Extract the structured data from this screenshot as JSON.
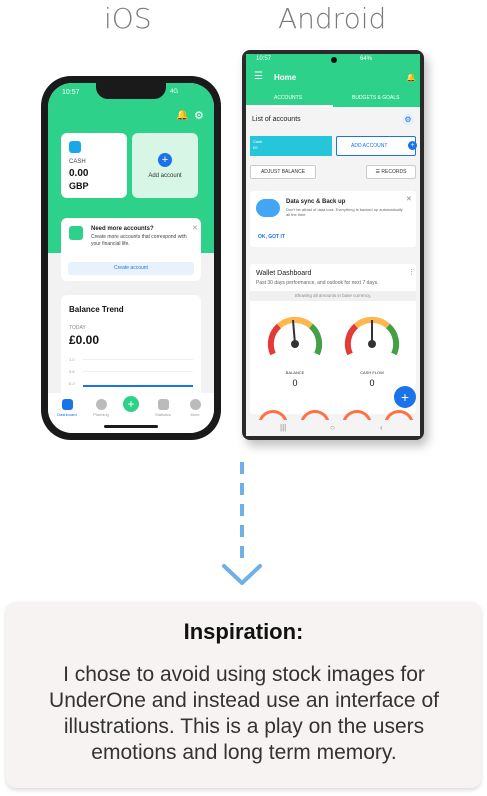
{
  "labels": {
    "ios": "iOS",
    "android": "Android"
  },
  "ios": {
    "status_time": "10:57",
    "status_signal": "4G",
    "cash_label": "CASH",
    "cash_amount": "0.00",
    "cash_currency": "GBP",
    "add_account": "Add account",
    "more_accounts_title": "Need more accounts?",
    "more_accounts_body": "Create more accounts that correspond with your financial life.",
    "create_account": "Create account",
    "balance_trend_title": "Balance Trend",
    "today_label": "TODAY",
    "balance_amount": "£0.00",
    "axis_ticks": [
      "1.0",
      "0.6",
      "0.2"
    ],
    "tabs": [
      "Dashboard",
      "Planning",
      "",
      "Statistics",
      "More"
    ]
  },
  "android": {
    "status_time": "10:57",
    "status_battery": "64%",
    "title": "Home",
    "tab_accounts": "ACCOUNTS",
    "tab_budgets": "BUDGETS & GOALS",
    "list_title": "List of accounts",
    "cash_tile_label": "Cash",
    "cash_tile_value": "£0",
    "add_account": "ADD ACCOUNT",
    "adjust_balance": "ADJUST BALANCE",
    "records": "RECORDS",
    "sync_title": "Data sync & Back up",
    "sync_body": "Don't be afraid of data loss. Everything is backed up automatically all the time.",
    "sync_ok": "OK, GOT IT",
    "dashboard_title": "Wallet Dashboard",
    "dashboard_sub": "Past 30 days performance, and outlook for next 7 days.",
    "base_currency_note": "Showing all amounts in base currency.",
    "gauge_balance_label": "BALANCE",
    "gauge_balance_value": "0",
    "gauge_cashflow_label": "CASH FLOW",
    "gauge_cashflow_value": "0"
  },
  "inspiration": {
    "title": "Inspiration:",
    "body": "I chose to avoid using stock images for UnderOne and instead use an interface of illustrations. This is a play on the users emotions and long term memory."
  },
  "colors": {
    "brand_green": "#2ed18a",
    "accent_blue": "#1a73e8",
    "cash_teal": "#26c6da",
    "connector_blue": "#6fb0e8"
  },
  "icons": [
    "bell-icon",
    "gear-icon",
    "plus-icon",
    "close-icon",
    "menu-icon",
    "cloud-icon",
    "records-icon",
    "chevron-down-icon"
  ]
}
